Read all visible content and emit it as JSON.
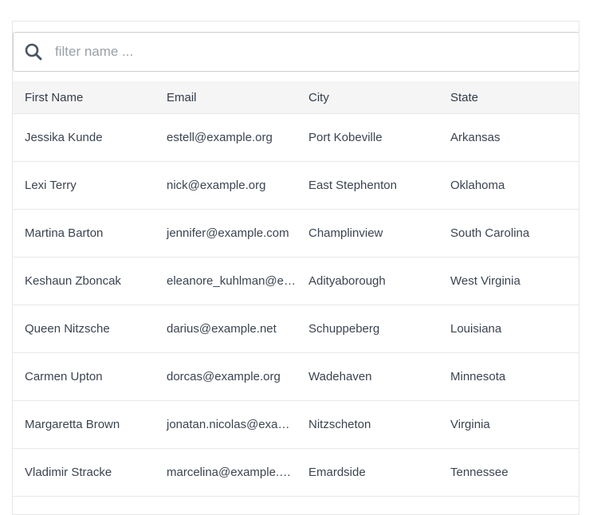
{
  "search": {
    "placeholder": "filter name ...",
    "value": ""
  },
  "table": {
    "headers": [
      "First Name",
      "Email",
      "City",
      "State"
    ],
    "rows": [
      {
        "name": "Jessika Kunde",
        "email": "estell@example.org",
        "city": "Port Kobeville",
        "state": "Arkansas"
      },
      {
        "name": "Lexi Terry",
        "email": "nick@example.org",
        "city": "East Stephenton",
        "state": "Oklahoma"
      },
      {
        "name": "Martina Barton",
        "email": "jennifer@example.com",
        "city": "Champlinview",
        "state": "South Carolina"
      },
      {
        "name": "Keshaun Zboncak",
        "email": "eleanore_kuhlman@example.com",
        "city": "Adityaborough",
        "state": "West Virginia"
      },
      {
        "name": "Queen Nitzsche",
        "email": "darius@example.net",
        "city": "Schuppeberg",
        "state": "Louisiana"
      },
      {
        "name": "Carmen Upton",
        "email": "dorcas@example.org",
        "city": "Wadehaven",
        "state": "Minnesota"
      },
      {
        "name": "Margaretta Brown",
        "email": "jonatan.nicolas@example.com",
        "city": "Nitzscheton",
        "state": "Virginia"
      },
      {
        "name": "Vladimir Stracke",
        "email": "marcelina@example.com",
        "city": "Emardside",
        "state": "Tennessee"
      }
    ]
  },
  "icons": {
    "search": "search-icon"
  },
  "colors": {
    "header_bg": "#f5f5f5",
    "text": "#3b4450",
    "border": "#e6e6e6",
    "placeholder": "#9aa0a6"
  }
}
